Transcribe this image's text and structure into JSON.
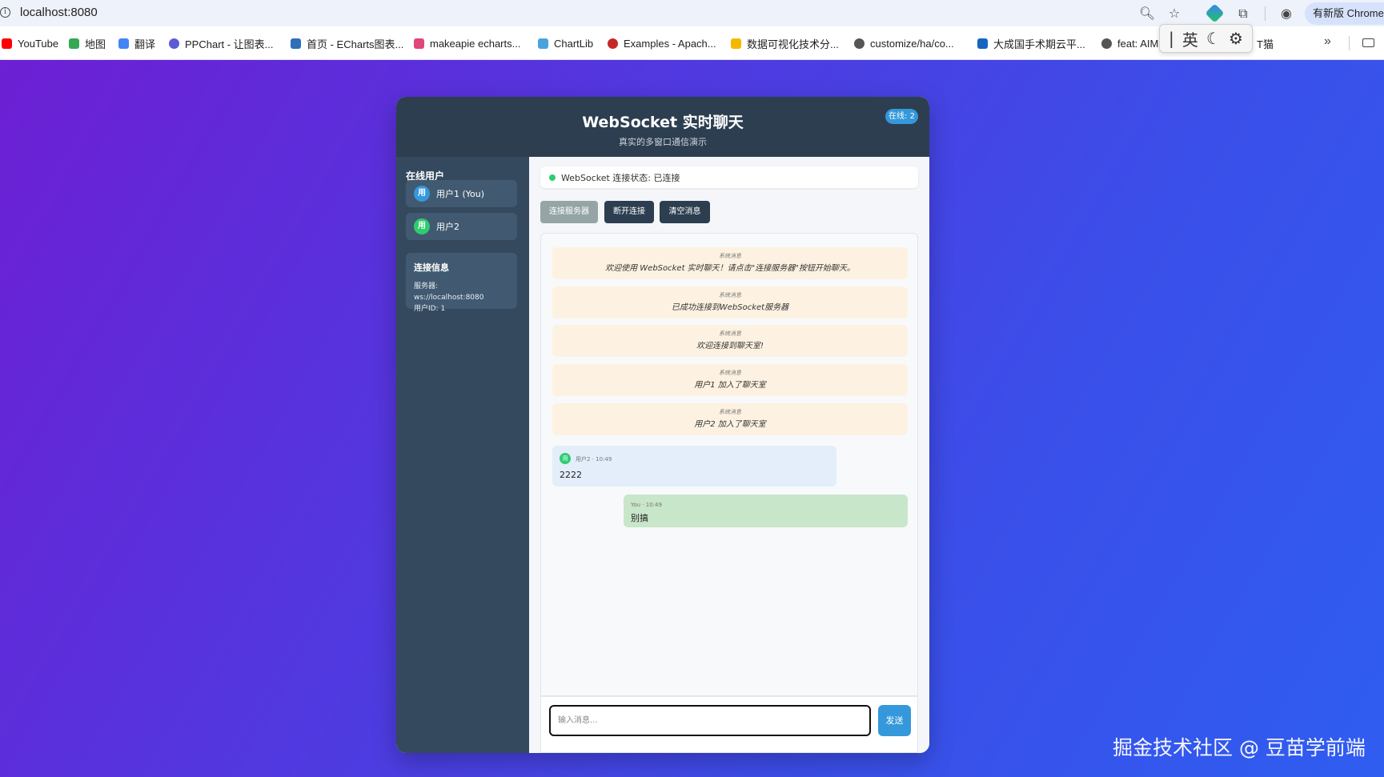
{
  "browser": {
    "url": "localhost:8080",
    "update_label": "有新版 Chrome",
    "icons": [
      "info-icon",
      "zoom-icon",
      "star-icon",
      "extension-icon",
      "puzzle-icon",
      "profile-icon",
      "more-icon",
      "folder-icon"
    ],
    "bookmarks": [
      {
        "label": "YouTube",
        "color": "#ff0000"
      },
      {
        "label": "地图",
        "color": "#34a853"
      },
      {
        "label": "翻译",
        "color": "#4285f4"
      },
      {
        "label": "PPChart - 让图表...",
        "color": "#5b5bd6"
      },
      {
        "label": "首页 - ECharts图表...",
        "color": "#2f6fb5"
      },
      {
        "label": "makeapie echarts...",
        "color": "#e0457b"
      },
      {
        "label": "ChartLib",
        "color": "#4aa3df"
      },
      {
        "label": "Examples - Apach...",
        "color": "#c62828"
      },
      {
        "label": "数据可视化技术分...",
        "color": "#f5b800"
      },
      {
        "label": "customize/ha/co...",
        "color": "#555555"
      },
      {
        "label": "大成国手术期云平...",
        "color": "#1565c0"
      },
      {
        "label": "feat: AIM",
        "color": "#555555"
      },
      {
        "label": "T猫",
        "color": "#555555"
      }
    ],
    "ime": {
      "mode": "英"
    }
  },
  "app": {
    "title": "WebSocket 实时聊天",
    "subtitle": "真实的多窗口通信演示",
    "online_badge": "在线: 2"
  },
  "sidebar": {
    "title": "在线用户",
    "users": [
      {
        "avatar": "用",
        "name": "用户1 (You)",
        "color": "#3498db"
      },
      {
        "avatar": "用",
        "name": "用户2",
        "color": "#2ecc71"
      }
    ],
    "connection_info": {
      "title": "连接信息",
      "server": "服务器: ws://localhost:8080",
      "user_id": "用户ID: 1"
    }
  },
  "main": {
    "status": "WebSocket 连接状态: 已连接",
    "buttons": {
      "connect": "连接服务器",
      "disconnect": "断开连接",
      "clear": "清空消息"
    },
    "system_messages": [
      {
        "label": "系统消息",
        "text": "欢迎使用 WebSocket 实时聊天！请点击\"连接服务器\"按钮开始聊天。"
      },
      {
        "label": "系统消息",
        "text": "已成功连接到WebSocket服务器"
      },
      {
        "label": "系统消息",
        "text": "欢迎连接到聊天室!"
      },
      {
        "label": "系统消息",
        "text": "用户1 加入了聊天室"
      },
      {
        "label": "系统消息",
        "text": "用户2 加入了聊天室"
      }
    ],
    "chat_messages": [
      {
        "avatar": "用",
        "meta": "用户2 · 10:49",
        "text": "2222"
      },
      {
        "meta": "You · 10:49",
        "text": "别搞"
      }
    ],
    "input_placeholder": "输入消息...",
    "send_label": "发送"
  },
  "watermark": "掘金技术社区 @ 豆苗学前端",
  "colors": {
    "header": "#2c3e50",
    "sidebar": "#34495e",
    "accent": "#3498db",
    "online": "#2ecc71",
    "system_bg": "#fdf2e1",
    "mine_bg": "#c8e6c9",
    "other_bg": "#e3eefa"
  }
}
